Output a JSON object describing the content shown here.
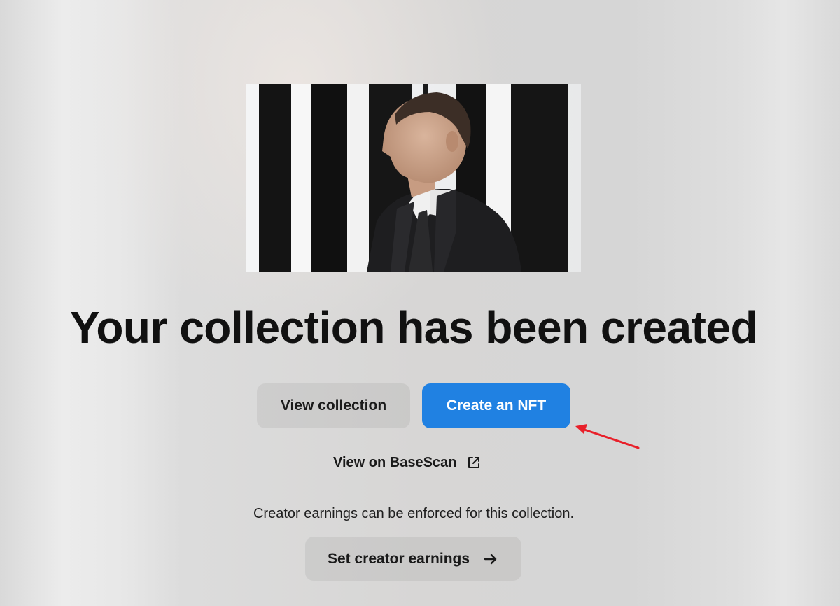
{
  "hero": {
    "image_alt": "Collection image"
  },
  "title": "Your collection has been created",
  "actions": {
    "view_collection": "View collection",
    "create_nft": "Create an NFT"
  },
  "explorer_link": {
    "label": "View on BaseScan",
    "icon": "external-link-icon"
  },
  "earnings": {
    "note": "Creator earnings can be enforced for this collection.",
    "button_label": "Set creator earnings",
    "icon": "arrow-right-icon"
  },
  "colors": {
    "primary": "#2081e2",
    "annotation": "#e8202a"
  }
}
